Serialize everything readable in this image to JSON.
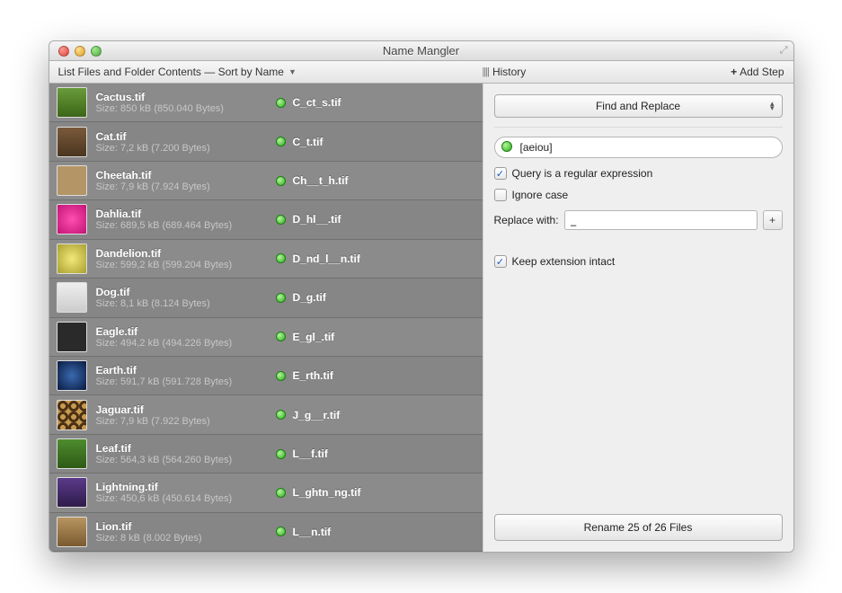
{
  "window": {
    "title": "Name Mangler"
  },
  "toolbar": {
    "left": "List Files and Folder Contents — Sort by Name",
    "history": "History",
    "add_step": "Add Step"
  },
  "files": [
    {
      "name": "Cactus.tif",
      "size": "Size: 850 kB (850.040 Bytes)",
      "new": "C_ct_s.tif",
      "thumb": "tc-green"
    },
    {
      "name": "Cat.tif",
      "size": "Size: 7,2 kB (7.200 Bytes)",
      "new": "C_t.tif",
      "thumb": "tc-brown"
    },
    {
      "name": "Cheetah.tif",
      "size": "Size: 7,9 kB (7.924 Bytes)",
      "new": "Ch__t_h.tif",
      "thumb": "tc-tan"
    },
    {
      "name": "Dahlia.tif",
      "size": "Size: 689,5 kB (689.464 Bytes)",
      "new": "D_hl__.tif",
      "thumb": "tc-pink"
    },
    {
      "name": "Dandelion.tif",
      "size": "Size: 599,2 kB (599.204 Bytes)",
      "new": "D_nd_l__n.tif",
      "thumb": "tc-yellow"
    },
    {
      "name": "Dog.tif",
      "size": "Size: 8,1 kB (8.124 Bytes)",
      "new": "D_g.tif",
      "thumb": "tc-white"
    },
    {
      "name": "Eagle.tif",
      "size": "Size: 494,2 kB (494.226 Bytes)",
      "new": "E_gl_.tif",
      "thumb": "tc-dark"
    },
    {
      "name": "Earth.tif",
      "size": "Size: 591,7 kB (591.728 Bytes)",
      "new": "E_rth.tif",
      "thumb": "tc-blue"
    },
    {
      "name": "Jaguar.tif",
      "size": "Size: 7,9 kB (7.922 Bytes)",
      "new": "J_g__r.tif",
      "thumb": "tc-spot"
    },
    {
      "name": "Leaf.tif",
      "size": "Size: 564,3 kB (564.260 Bytes)",
      "new": "L__f.tif",
      "thumb": "tc-leaf"
    },
    {
      "name": "Lightning.tif",
      "size": "Size: 450,6 kB (450.614 Bytes)",
      "new": "L_ghtn_ng.tif",
      "thumb": "tc-purple"
    },
    {
      "name": "Lion.tif",
      "size": "Size: 8 kB (8.002 Bytes)",
      "new": "L__n.tif",
      "thumb": "tc-lion"
    }
  ],
  "panel": {
    "operation": "Find and Replace",
    "search_value": "[aeiou]",
    "regex_label": "Query is a regular expression",
    "regex_checked": true,
    "ignorecase_label": "Ignore case",
    "ignorecase_checked": false,
    "replace_label": "Replace with:",
    "replace_value": "_",
    "keep_ext_label": "Keep extension intact",
    "keep_ext_checked": true,
    "rename_button": "Rename 25 of 26 Files"
  }
}
